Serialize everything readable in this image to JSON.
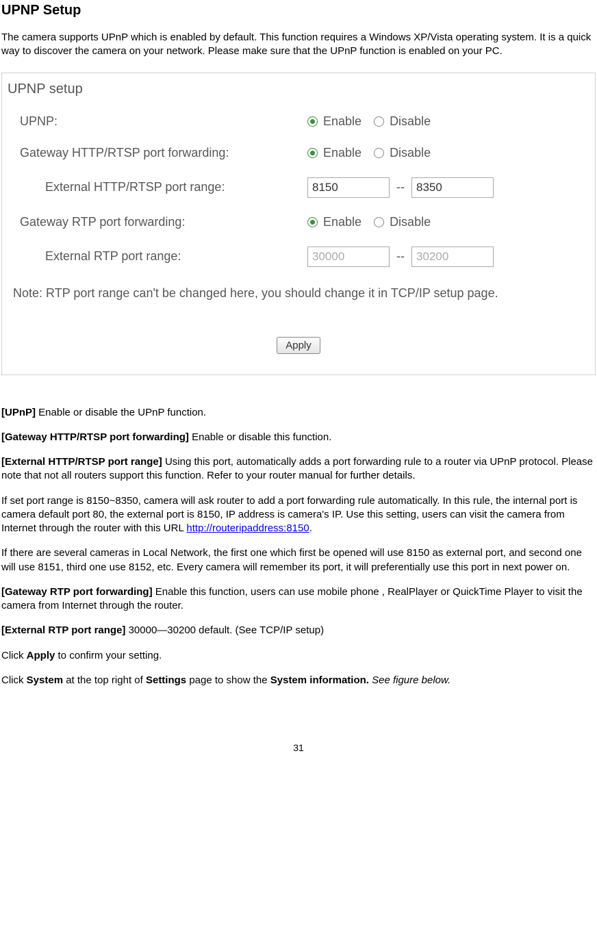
{
  "title": "UPNP Setup",
  "intro": "The camera supports UPnP which is enabled by default. This function requires a Windows XP/Vista operating system. It is a quick way to discover the camera on your network. Please make sure that the UPnP function is enabled on your PC.",
  "panel": {
    "heading": "UPNP setup",
    "rows": {
      "upnp_label": "UPNP:",
      "gw_http_label": "Gateway HTTP/RTSP port forwarding:",
      "ext_http_label": "External HTTP/RTSP port range:",
      "gw_rtp_label": "Gateway RTP port forwarding:",
      "ext_rtp_label": "External RTP port range:"
    },
    "options": {
      "enable": "Enable",
      "disable": "Disable",
      "separator": "--"
    },
    "values": {
      "http_from": "8150",
      "http_to": "8350",
      "rtp_from": "30000",
      "rtp_to": "30200"
    },
    "note": "Note: RTP port range can't be changed here, you should change it in TCP/IP setup page.",
    "apply": "Apply"
  },
  "defs": {
    "d1_term": "[UPnP] ",
    "d1_text": "Enable or disable the UPnP function.",
    "d2_term": "[Gateway HTTP/RTSP port forwarding] ",
    "d2_text": "Enable or disable this function.",
    "d3_term": "[External HTTP/RTSP port range] ",
    "d3_text": "Using this port, automatically adds a port forwarding rule to a router via UPnP protocol. Please note that not all routers support this function. Refer to your router manual for further details.",
    "p4a": "If set port range is 8150~8350, camera will ask router to add a port forwarding rule automatically. In this rule, the internal port is camera default port 80, the external port is 8150, IP address is camera's IP. Use this setting, users can visit the camera from Internet through the router with this URL ",
    "p4_link": "http://routeripaddress:8150",
    "p4b": ".",
    "p5": "If there are several cameras in Local Network, the first one which first be opened will use 8150 as external port, and second one will use 8151, third one use 8152, etc. Every camera will remember its port, it will preferentially use this port in next power on.",
    "d6_term": "[Gateway RTP port forwarding] ",
    "d6_text": "Enable this function, users can use mobile phone , RealPlayer or QuickTime Player to visit the camera from Internet through the router.",
    "d7_term": "[External RTP port range] ",
    "d7_text": "30000—30200 default. (See TCP/IP setup)",
    "p8a": "Click ",
    "p8b": "Apply",
    "p8c": " to confirm your setting.",
    "p9a": "Click ",
    "p9b": "System",
    "p9c": " at the top right of ",
    "p9d": "Settings",
    "p9e": " page to show the ",
    "p9f": "System information. ",
    "p9g": "See figure below."
  },
  "page_number": "31"
}
